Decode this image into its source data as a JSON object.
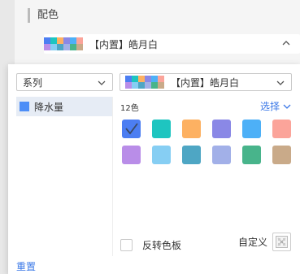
{
  "section": {
    "title": "配色"
  },
  "top_select": {
    "value": "【内置】皓月白"
  },
  "popup": {
    "series_select": {
      "value": "系列"
    },
    "palette_select": {
      "value": "【内置】皓月白"
    },
    "series_list": [
      {
        "name": "降水量",
        "color": "#4d8ef7"
      }
    ],
    "count_label": "12色",
    "choose_label": "选择",
    "colors": [
      "#4c7ef2",
      "#1ec5c0",
      "#fdb162",
      "#8a88e6",
      "#4db0f7",
      "#fba49a",
      "#b98de8",
      "#86cef3",
      "#4ea6c4",
      "#a2b0e8",
      "#48b48b",
      "#c9aa89"
    ],
    "selected_color_index": 0,
    "reverse_label": "反转色板",
    "custom_label": "自定义",
    "reset_label": "重置"
  },
  "mini_palette": [
    "#4c7ef2",
    "#1ec5c0",
    "#fdb162",
    "#8a88e6",
    "#4db0f7",
    "#fba49a",
    "#b98de8",
    "#86cef3",
    "#4ea6c4",
    "#a2b0e8",
    "#48b48b",
    "#c9aa89"
  ],
  "icons": {
    "chevron_down": "chevron-down-icon",
    "chevron_up": "chevron-up-icon",
    "check": "check-icon",
    "custom": "color-picker-icon"
  }
}
